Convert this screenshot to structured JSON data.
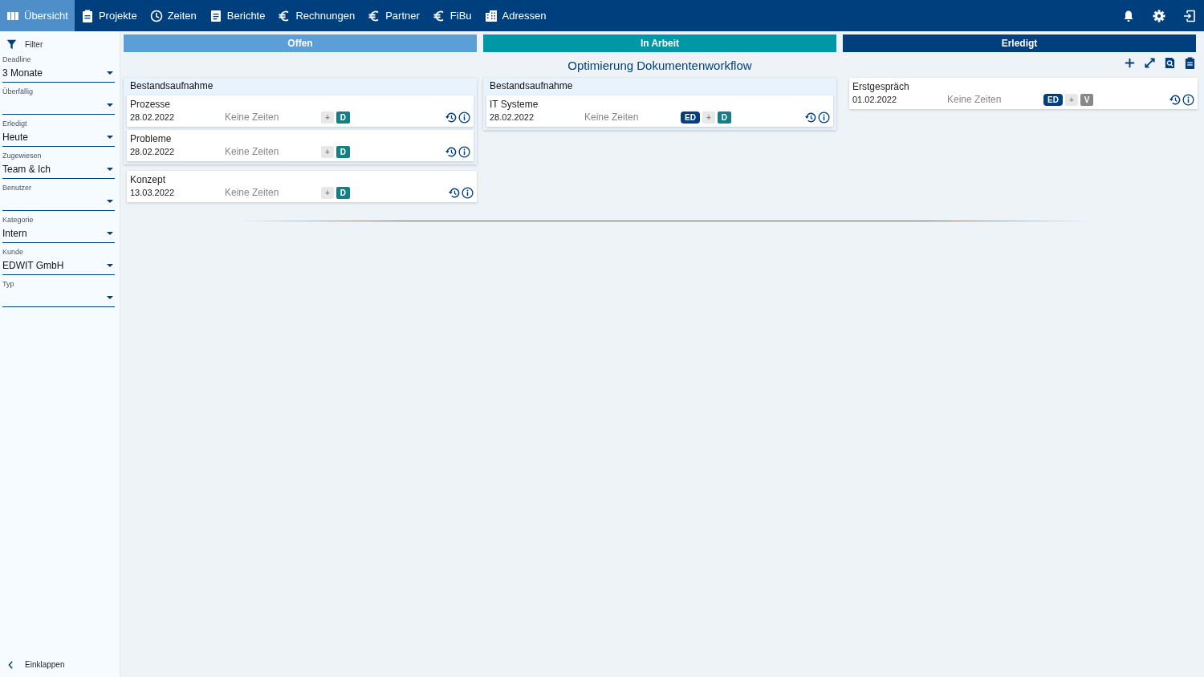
{
  "nav": {
    "items": [
      {
        "label": "Übersicht",
        "selected": true
      },
      {
        "label": "Projekte",
        "selected": false
      },
      {
        "label": "Zeiten",
        "selected": false
      },
      {
        "label": "Berichte",
        "selected": false
      },
      {
        "label": "Rechnungen",
        "selected": false
      },
      {
        "label": "Partner",
        "selected": false
      },
      {
        "label": "FiBu",
        "selected": false
      },
      {
        "label": "Adressen",
        "selected": false
      }
    ]
  },
  "sidebar": {
    "title": "Filter",
    "filters": [
      {
        "label": "Deadline",
        "value": "3 Monate"
      },
      {
        "label": "Überfällig"
      },
      {
        "label": "Erledigt",
        "value": "Heute"
      },
      {
        "label": "Zugewiesen",
        "value": "Team & Ich"
      },
      {
        "label": "Benutzer"
      },
      {
        "label": "Kategorie",
        "value": "Intern"
      },
      {
        "label": "Kunde",
        "value": "EDWIT GmbH"
      },
      {
        "label": "Typ"
      }
    ],
    "collapse": "Einklappen"
  },
  "columns": [
    {
      "title": "Offen",
      "color": "#5b9fd9"
    },
    {
      "title": "In Arbeit",
      "color": "#0097a7"
    },
    {
      "title": "Erledigt",
      "color": "#003f7d"
    }
  ],
  "project_title": "Optimierung Dokumentenworkflow",
  "lanes": [
    {
      "items": [
        {
          "kind": "group",
          "title": "Bestandsaufnahme",
          "cards": [
            {
              "name": "Prozesse",
              "date": "28.02.2022",
              "times": "Keine Zeiten",
              "badges": [
                {
                  "label": "+",
                  "kind": "add"
                },
                {
                  "label": "D",
                  "kind": "teal"
                }
              ]
            },
            {
              "name": "Probleme",
              "date": "28.02.2022",
              "times": "Keine Zeiten",
              "badges": [
                {
                  "label": "+",
                  "kind": "add"
                },
                {
                  "label": "D",
                  "kind": "teal"
                }
              ]
            }
          ]
        },
        {
          "kind": "card",
          "card": {
            "name": "Konzept",
            "date": "13.03.2022",
            "times": "Keine Zeiten",
            "badges": [
              {
                "label": "+",
                "kind": "add"
              },
              {
                "label": "D",
                "kind": "teal"
              }
            ]
          }
        }
      ]
    },
    {
      "items": [
        {
          "kind": "group",
          "title": "Bestandsaufnahme",
          "cards": [
            {
              "name": "IT Systeme",
              "date": "28.02.2022",
              "times": "Keine Zeiten",
              "badges": [
                {
                  "label": "ED",
                  "kind": "navy"
                },
                {
                  "label": "+",
                  "kind": "add"
                },
                {
                  "label": "D",
                  "kind": "teal"
                }
              ]
            }
          ]
        }
      ]
    },
    {
      "items": [
        {
          "kind": "card",
          "card": {
            "name": "Erstgespräch",
            "date": "01.02.2022",
            "times": "Keine Zeiten",
            "badges": [
              {
                "label": "ED",
                "kind": "navy"
              },
              {
                "label": "+",
                "kind": "add"
              },
              {
                "label": "V",
                "kind": "grey"
              }
            ]
          }
        }
      ]
    }
  ]
}
